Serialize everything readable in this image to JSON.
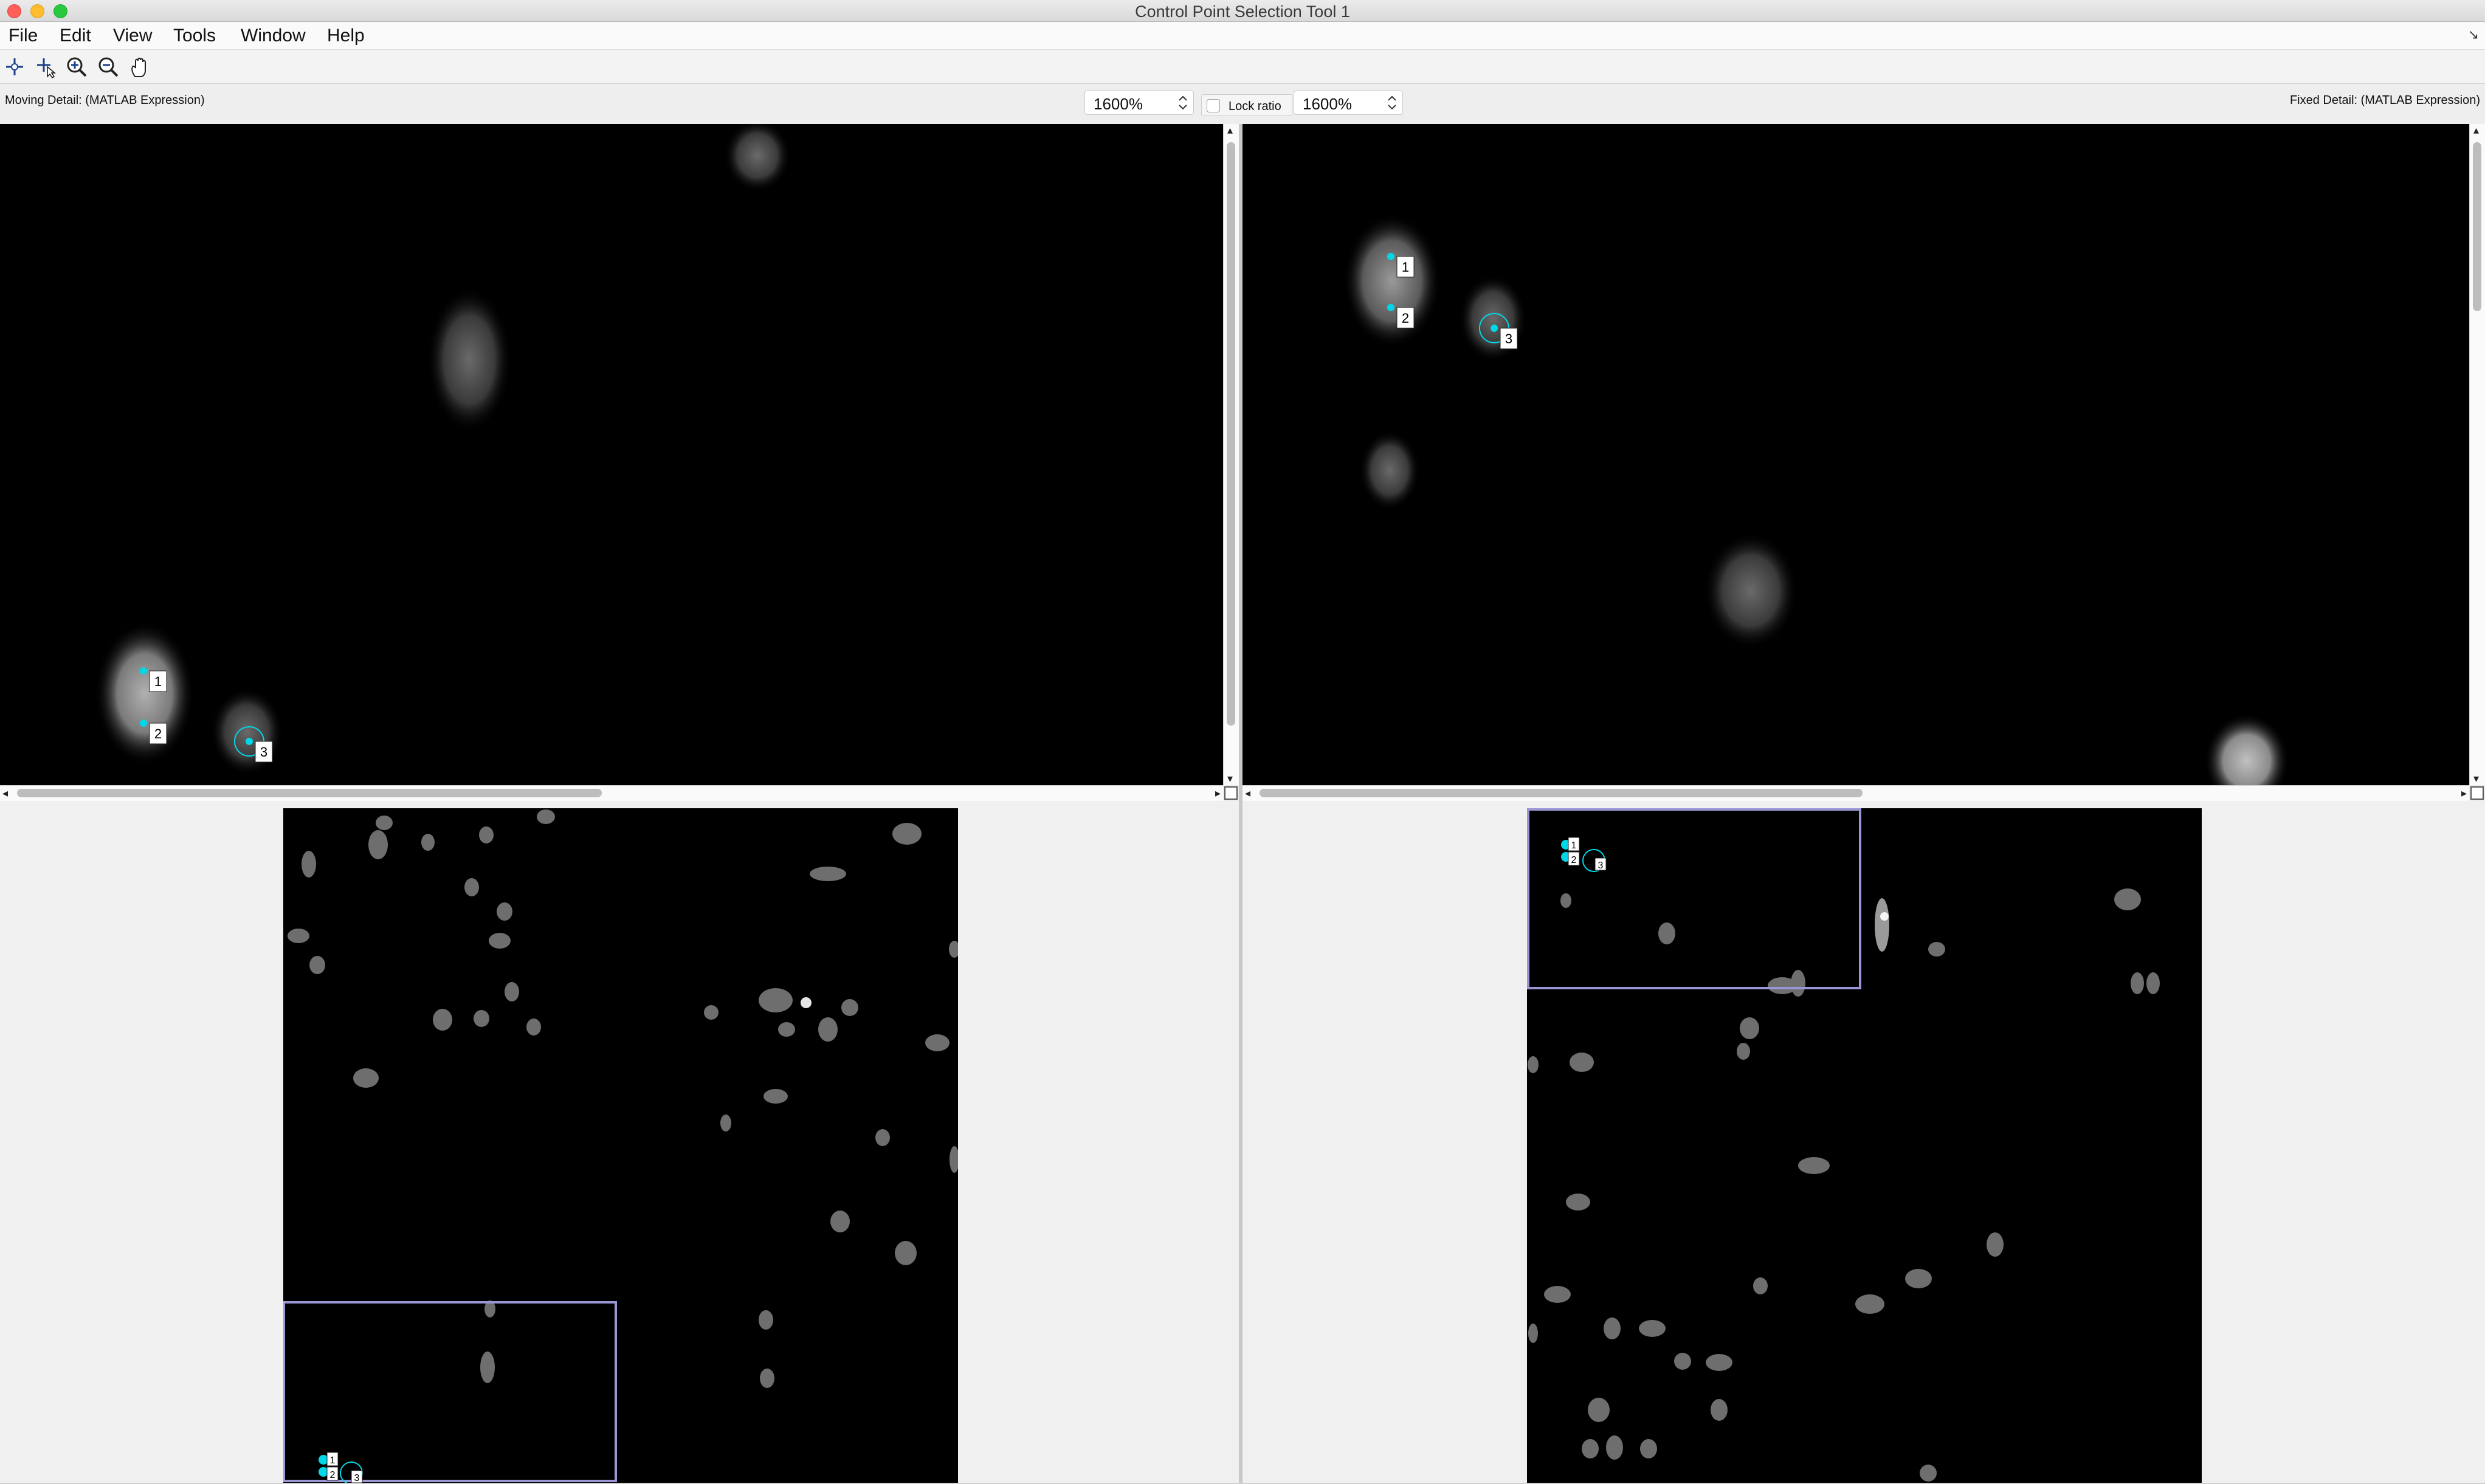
{
  "window": {
    "title": "Control Point Selection Tool 1"
  },
  "menu": {
    "items": [
      "File",
      "Edit",
      "View",
      "Tools",
      "Window",
      "Help"
    ]
  },
  "toolbar": {
    "tools": [
      "add-point-icon",
      "select-point-icon",
      "zoom-in-icon",
      "zoom-out-icon",
      "pan-hand-icon"
    ]
  },
  "detail": {
    "moving_label": "Moving Detail: (MATLAB Expression)",
    "fixed_label": "Fixed Detail: (MATLAB Expression)",
    "moving_zoom": "1600%",
    "fixed_zoom": "1600%",
    "lock_ratio_label": "Lock ratio",
    "lock_ratio_checked": false
  },
  "control_points": {
    "labels": [
      "1",
      "2",
      "3"
    ],
    "color": "#00d8e8"
  },
  "colors": {
    "overview_rect": "#9a96d6",
    "image_bg": "#000000"
  }
}
